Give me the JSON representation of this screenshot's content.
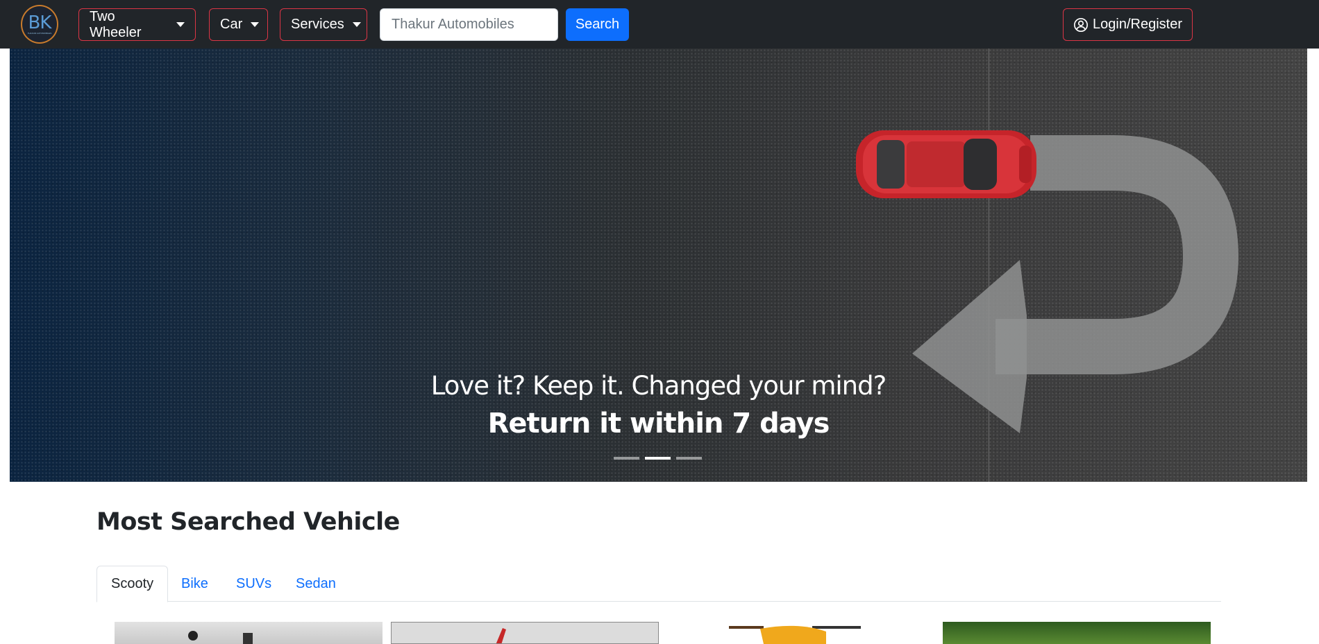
{
  "navbar": {
    "logo_text": "BK",
    "logo_subtext": "THAKUR AUTOMOBILES",
    "menus": [
      {
        "label": "Two Wheeler"
      },
      {
        "label": "Car"
      },
      {
        "label": "Services"
      }
    ],
    "search": {
      "placeholder": "Thakur Automobiles",
      "value": "",
      "button_label": "Search"
    },
    "login_label": "Login/Register",
    "accent_color": "#dc3545"
  },
  "hero": {
    "caption_line1": "Love it? Keep it. Changed your mind?",
    "caption_line2": "Return it within 7 days",
    "slide_count": 3,
    "active_slide": 2
  },
  "section": {
    "title": "Most Searched Vehicle",
    "tabs": [
      {
        "label": "Scooty",
        "active": true
      },
      {
        "label": "Bike",
        "active": false
      },
      {
        "label": "SUVs",
        "active": false
      },
      {
        "label": "Sedan",
        "active": false
      }
    ]
  },
  "icons": {
    "user": "user-circle-icon",
    "caret": "caret-down-icon"
  }
}
